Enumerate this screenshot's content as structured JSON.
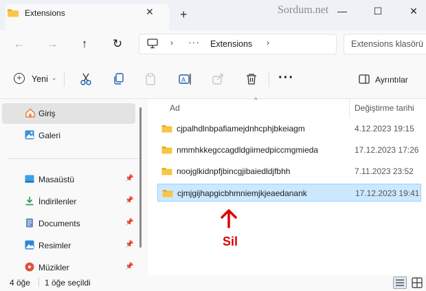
{
  "window": {
    "tab_title": "Extensions",
    "watermark": "Sordum.net",
    "minimize_glyph": "—",
    "maximize_glyph": "☐",
    "close_glyph": "✕",
    "tab_close_glyph": "✕",
    "new_tab_glyph": "+"
  },
  "nav": {
    "back_glyph": "←",
    "forward_glyph": "→",
    "up_glyph": "↑",
    "refresh_glyph": "↻",
    "address_chevron": "›",
    "address_overflow": "···",
    "address_path": "Extensions",
    "search_placeholder": "Extensions klasörü"
  },
  "toolbar": {
    "new_label": "Yeni",
    "new_chevron": "⌄",
    "more_glyph": "···",
    "details_label": "Ayrıntılar"
  },
  "sidebar": {
    "items": [
      {
        "label": "Giriş",
        "icon": "home-icon"
      },
      {
        "label": "Galeri",
        "icon": "gallery-icon"
      },
      {
        "label": "Masaüstü",
        "icon": "desktop-icon"
      },
      {
        "label": "İndirilenler",
        "icon": "downloads-icon"
      },
      {
        "label": "Documents",
        "icon": "documents-icon"
      },
      {
        "label": "Resimler",
        "icon": "pictures-icon"
      },
      {
        "label": "Müzikler",
        "icon": "music-icon"
      }
    ],
    "pin_glyph": "📌"
  },
  "columns": {
    "name": "Ad",
    "modified": "Değiştirme tarihi",
    "sort_glyph": "^"
  },
  "files": [
    {
      "name": "cjpalhdlnbpafiamejdnhcphjbkeiagm",
      "modified": "4.12.2023 19:15",
      "selected": false
    },
    {
      "name": "nmmhkkegccagdldgiimedpiccmgmieda",
      "modified": "17.12.2023 17:26",
      "selected": false
    },
    {
      "name": "noojglkidnpfjbincgjibaiedldjfbhh",
      "modified": "7.11.2023 23:52",
      "selected": false
    },
    {
      "name": "cjmjgijhapgicbhmniemjkjeaedanank",
      "modified": "17.12.2023 19:41",
      "selected": true
    }
  ],
  "annotation": {
    "label": "Sil",
    "color": "#e00000"
  },
  "status": {
    "count": "4 öğe",
    "selection": "1 öğe seçildi"
  },
  "colors": {
    "accent": "#0067c0",
    "folder": "#f8c646",
    "selection": "#cce8ff"
  }
}
